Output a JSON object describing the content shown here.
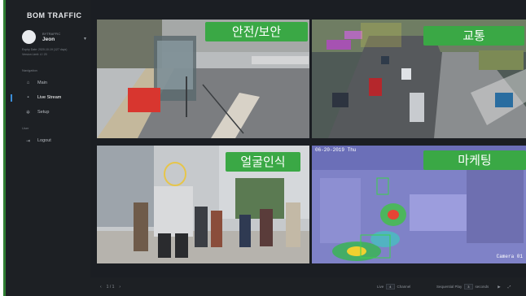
{
  "brand": "BOM TRAFFIC",
  "user": {
    "role": "BYTRAFFIC",
    "name": "Jeon",
    "expiry": "Expiry Date: 2020-10-19 (127 days)",
    "version": "Version Limit: 4 / 20"
  },
  "nav": {
    "section_label": "Navigation",
    "items": [
      {
        "label": "Main",
        "icon": "home-icon"
      },
      {
        "label": "Live Stream",
        "icon": "video-icon"
      },
      {
        "label": "Setup",
        "icon": "gear-icon"
      }
    ],
    "user_section_label": "User",
    "logout": {
      "label": "Logout",
      "icon": "logout-icon"
    }
  },
  "tiles": [
    {
      "label": "안전/보안"
    },
    {
      "label": "교통"
    },
    {
      "label": "얼굴인식"
    },
    {
      "label": "마케팅",
      "timestamp": "06-20-2019 Thu",
      "camera": "Camera 01"
    }
  ],
  "pager": {
    "prev": "‹",
    "page": "1 / 1",
    "next": "›"
  },
  "controls": {
    "live_label": "Live",
    "live_value": "4",
    "channel_label": "Channel",
    "seq_label": "Sequential Play",
    "seq_value": "3",
    "seconds_label": "seconds"
  },
  "colors": {
    "accent": "#3aa845",
    "active": "#3b8ed8",
    "sidebar": "#1d2024"
  }
}
